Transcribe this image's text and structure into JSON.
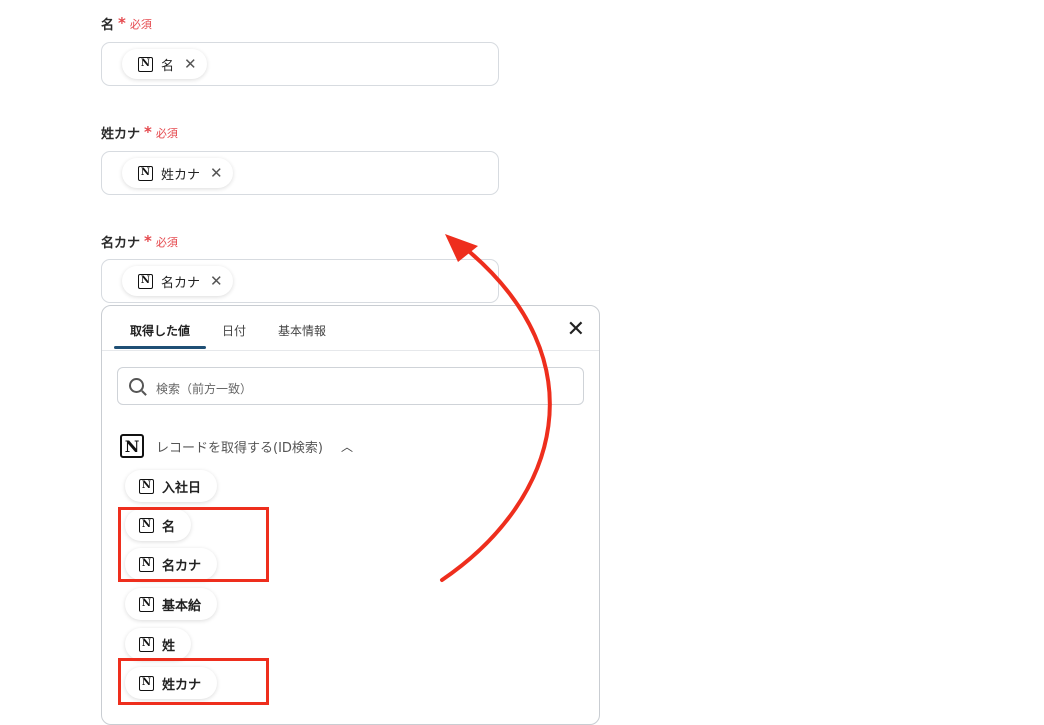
{
  "required_text": "必須",
  "fields": [
    {
      "label": "名",
      "chip": "名"
    },
    {
      "label": "姓カナ",
      "chip": "姓カナ"
    },
    {
      "label": "名カナ",
      "chip": "名カナ"
    }
  ],
  "panel": {
    "tabs": [
      "取得した値",
      "日付",
      "基本情報"
    ],
    "active_tab": "取得した値",
    "search_placeholder": "検索（前方一致）",
    "group_title": "レコードを取得する(ID検索)",
    "items": [
      "入社日",
      "名",
      "名カナ",
      "基本給",
      "姓",
      "姓カナ"
    ],
    "highlighted_items": [
      "名",
      "名カナ",
      "姓カナ"
    ]
  },
  "colors": {
    "accent": "#1f4f75",
    "required": "#e5484d",
    "annotation": "#ee2e1d"
  },
  "icons": [
    "notion-icon",
    "close-icon",
    "search-icon",
    "chevron-up-icon"
  ]
}
